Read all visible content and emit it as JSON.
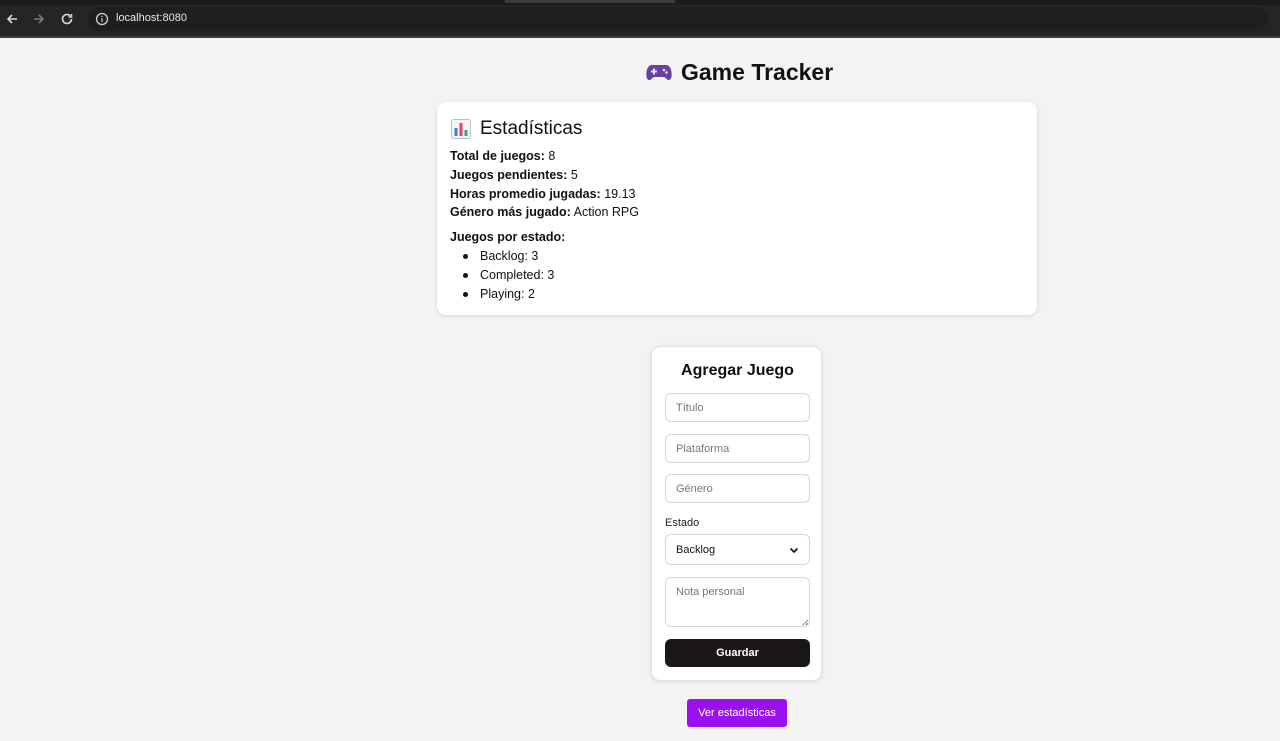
{
  "browser": {
    "url": "localhost:8080",
    "icons": [
      "back-arrow-icon",
      "forward-arrow-icon",
      "reload-icon",
      "info-icon"
    ]
  },
  "header": {
    "title": "Game Tracker",
    "icon": "gamepad-icon"
  },
  "stats": {
    "title": "Estadísticas",
    "icon": "bar-chart-icon",
    "total_label": "Total de juegos:",
    "total_value": "8",
    "pending_label": "Juegos pendientes:",
    "pending_value": "5",
    "avg_hours_label": "Horas promedio jugadas:",
    "avg_hours_value": "19.13",
    "top_genre_label": "Género más jugado:",
    "top_genre_value": "Action RPG",
    "by_state_label": "Juegos por estado:",
    "by_state": [
      {
        "text": "Backlog: 3"
      },
      {
        "text": "Completed: 3"
      },
      {
        "text": "Playing: 2"
      }
    ]
  },
  "form": {
    "title": "Agregar Juego",
    "title_placeholder": "Título",
    "platform_placeholder": "Plataforma",
    "genre_placeholder": "Género",
    "estado_label": "Estado",
    "estado_value": "Backlog",
    "note_placeholder": "Nota personal",
    "save_label": "Guardar"
  },
  "footer": {
    "stats_button_label": "Ver estadísticas"
  },
  "colors": {
    "accent": "#9b10f1",
    "dark_button": "#1c1717",
    "page_bg": "#f3f3f2"
  }
}
